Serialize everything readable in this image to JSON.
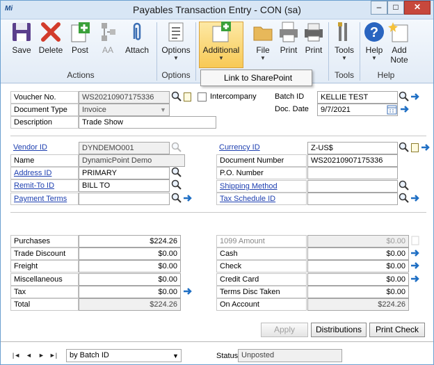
{
  "window": {
    "title": "Payables Transaction Entry  -  CON (sa)",
    "app_icon": "Mi"
  },
  "ribbon": {
    "buttons": {
      "save": "Save",
      "delete": "Delete",
      "post": "Post",
      "aa": "AA",
      "attach": "Attach",
      "options": "Options",
      "additional": "Additional",
      "file": "File",
      "print": "Print",
      "print2": "Print",
      "tools": "Tools",
      "help": "Help",
      "add_note_1": "Add",
      "add_note_2": "Note"
    },
    "groups": {
      "actions": "Actions",
      "options": "Options",
      "tools": "Tools",
      "help": "Help"
    },
    "dropdown_item": "Link to SharePoint"
  },
  "form": {
    "labels": {
      "voucher_no": "Voucher No.",
      "document_type": "Document Type",
      "description": "Description",
      "intercompany": "Intercompany",
      "batch_id": "Batch ID",
      "doc_date": "Doc. Date",
      "vendor_id": "Vendor ID",
      "name": "Name",
      "address_id": "Address ID",
      "remit_to_id": "Remit-To ID",
      "payment_terms": "Payment Terms",
      "currency_id": "Currency ID",
      "document_number": "Document Number",
      "po_number": "P.O. Number",
      "shipping_method": "Shipping Method",
      "tax_schedule_id": "Tax Schedule ID"
    },
    "values": {
      "voucher_no": "WS20210907175336",
      "document_type": "Invoice",
      "description": "Trade Show",
      "batch_id": "KELLIE TEST",
      "doc_date": "9/7/2021",
      "vendor_id": "DYNDEMO001",
      "name": "DynamicPoint Demo",
      "address_id": "PRIMARY",
      "remit_to_id": "BILL TO",
      "payment_terms": "",
      "currency_id": "Z-US$",
      "document_number": "WS20210907175336",
      "po_number": "",
      "shipping_method": "",
      "tax_schedule_id": ""
    },
    "intercompany_checked": false
  },
  "amounts_left": [
    {
      "label": "Purchases",
      "value": "$224.26"
    },
    {
      "label": "Trade Discount",
      "value": "$0.00"
    },
    {
      "label": "Freight",
      "value": "$0.00"
    },
    {
      "label": "Miscellaneous",
      "value": "$0.00"
    },
    {
      "label": "Tax",
      "value": "$0.00"
    },
    {
      "label": "Total",
      "value": "$224.26"
    }
  ],
  "amounts_right": [
    {
      "label": "1099 Amount",
      "value": "$0.00"
    },
    {
      "label": "Cash",
      "value": "$0.00"
    },
    {
      "label": "Check",
      "value": "$0.00"
    },
    {
      "label": "Credit Card",
      "value": "$0.00"
    },
    {
      "label": "Terms Disc Taken",
      "value": "$0.00"
    },
    {
      "label": "On Account",
      "value": "$224.26"
    }
  ],
  "buttons": {
    "apply": "Apply",
    "distributions": "Distributions",
    "print_check": "Print Check"
  },
  "footer": {
    "sort_by": "by Batch ID",
    "status_label": "Status",
    "status_value": "Unposted",
    "nav": {
      "first": "|◄",
      "prev": "◄",
      "next": "►",
      "last": "►|"
    }
  },
  "colors": {
    "link": "#1d3fb0",
    "highlight": "#f8c955",
    "ribbon": "#e2ebf6",
    "arrow": "#1f6fc4"
  }
}
